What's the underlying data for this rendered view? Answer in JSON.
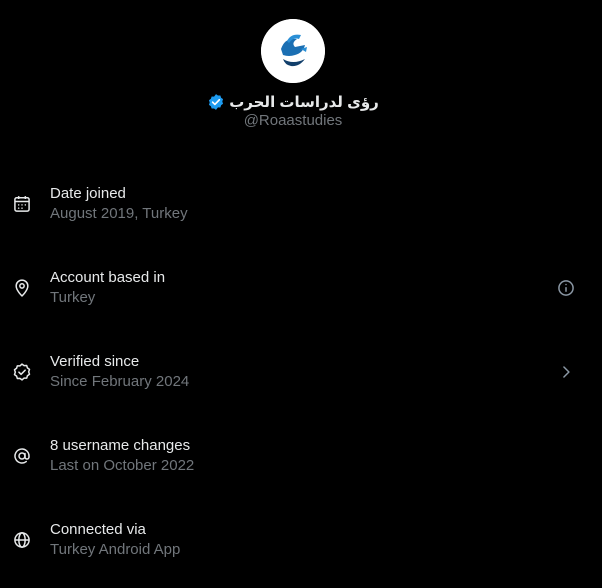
{
  "profile": {
    "display_name": "رؤى لدراسات الحرب",
    "handle": "@Roaastudies",
    "verified_color": "#1d9bf0"
  },
  "colors": {
    "background": "#000000",
    "primary_text": "#e7e9ea",
    "secondary_text": "#71767b"
  },
  "rows": [
    {
      "icon": "calendar-icon",
      "title": "Date joined",
      "subtitle": "August 2019, Turkey",
      "action": ""
    },
    {
      "icon": "location-pin-icon",
      "title": "Account based in",
      "subtitle": "Turkey",
      "action": "info-icon"
    },
    {
      "icon": "verified-check-icon",
      "title": "Verified since",
      "subtitle": "Since February 2024",
      "action": "chevron-right-icon"
    },
    {
      "icon": "at-sign-icon",
      "title": "8 username changes",
      "subtitle": "Last on October 2022",
      "action": ""
    },
    {
      "icon": "globe-icon",
      "title": "Connected via",
      "subtitle": "Turkey Android App",
      "action": ""
    }
  ]
}
